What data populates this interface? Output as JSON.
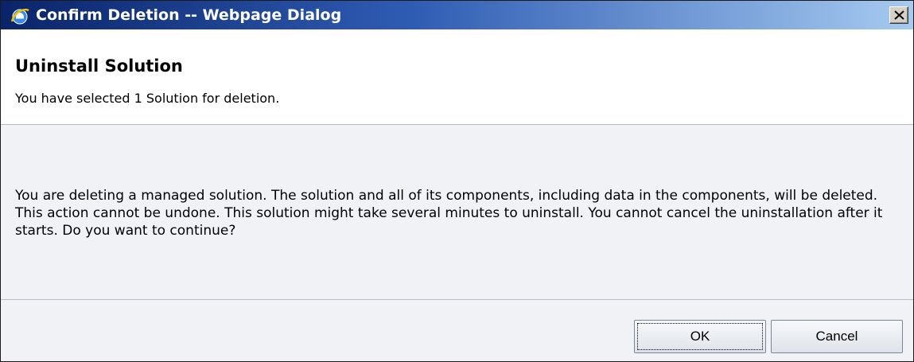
{
  "window": {
    "title": "Confirm Deletion -- Webpage Dialog",
    "app_icon": "internet-explorer-icon",
    "close_icon": "close-icon"
  },
  "dialog": {
    "title": "Uninstall Solution",
    "subtitle": "You have selected 1 Solution for deletion.",
    "message": "You are deleting a managed solution. The solution and all of its components, including data in the components, will be deleted. This action cannot be undone. This solution might take several minutes to uninstall. You cannot cancel the uninstallation after it starts. Do you want to continue?"
  },
  "buttons": {
    "ok_label": "OK",
    "cancel_label": "Cancel"
  },
  "colors": {
    "titlebar_start": "#0a246a",
    "titlebar_end": "#a6caf0",
    "body_background": "#f0f2f6",
    "header_background": "#ffffff"
  }
}
